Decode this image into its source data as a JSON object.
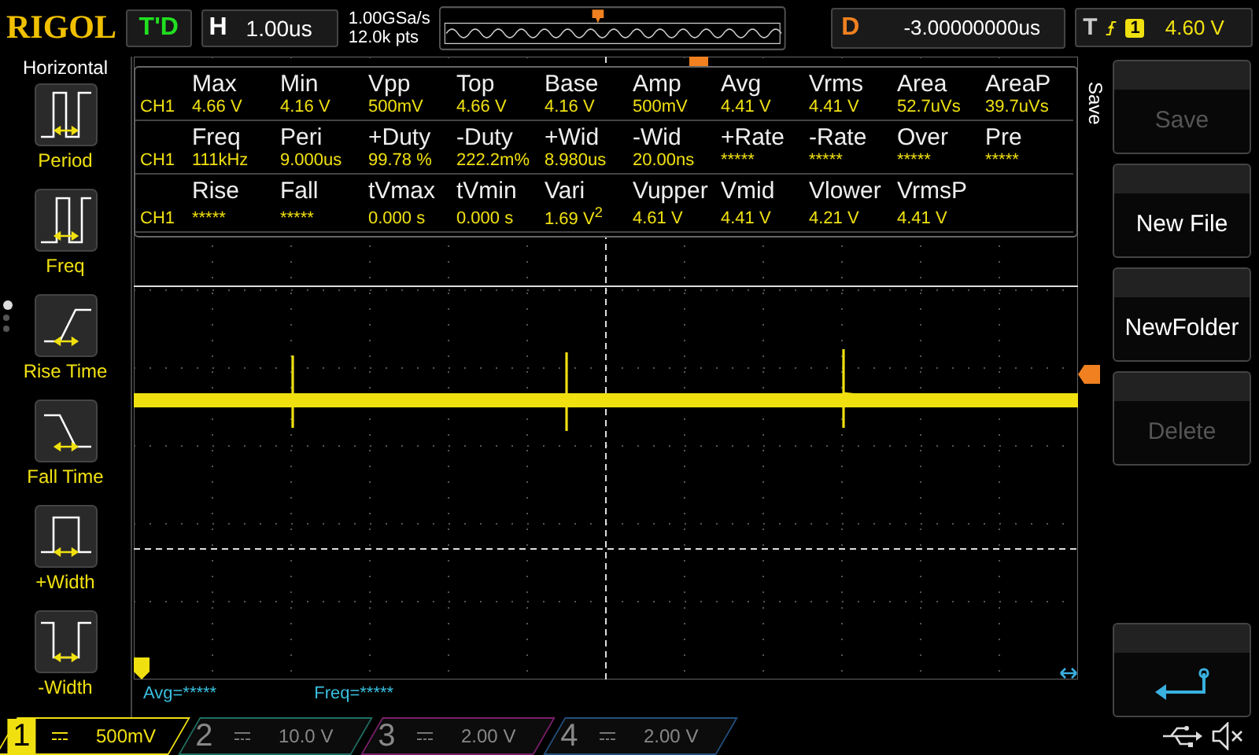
{
  "brand": "RIGOL",
  "run_status": "T'D",
  "timebase": {
    "label": "H",
    "value": "1.00us"
  },
  "sample_rate": "1.00GSa/s",
  "memory_depth": "12.0k pts",
  "delay": {
    "label": "D",
    "value": "-3.00000000us"
  },
  "trigger": {
    "label": "T",
    "source": "1",
    "level": "4.60 V"
  },
  "left_panel": {
    "title": "Horizontal",
    "items": [
      {
        "label": "Period",
        "kind": "period"
      },
      {
        "label": "Freq",
        "kind": "freq"
      },
      {
        "label": "Rise Time",
        "kind": "rise"
      },
      {
        "label": "Fall Time",
        "kind": "fall"
      },
      {
        "label": "+Width",
        "kind": "pwidth"
      },
      {
        "label": "-Width",
        "kind": "nwidth"
      }
    ],
    "pages": [
      {
        "selected": true
      },
      {
        "selected": false
      },
      {
        "selected": false
      }
    ]
  },
  "measurements": [
    {
      "channel": "CH1",
      "names": [
        "Max",
        "Min",
        "Vpp",
        "Top",
        "Base",
        "Amp",
        "Avg",
        "Vrms",
        "Area",
        "AreaP"
      ],
      "values": [
        "4.66 V",
        "4.16 V",
        "500mV",
        "4.66 V",
        "4.16 V",
        "500mV",
        "4.41 V",
        "4.41 V",
        "52.7uVs",
        "39.7uVs"
      ]
    },
    {
      "channel": "CH1",
      "names": [
        "Freq",
        "Peri",
        "+Duty",
        "-Duty",
        "+Wid",
        "-Wid",
        "+Rate",
        "-Rate",
        "Over",
        "Pre"
      ],
      "values": [
        "111kHz",
        "9.000us",
        "99.78 %",
        "222.2m%",
        "8.980us",
        "20.00ns",
        "*****",
        "*****",
        "*****",
        "*****"
      ]
    },
    {
      "channel": "CH1",
      "names": [
        "Rise",
        "Fall",
        "tVmax",
        "tVmin",
        "Vari",
        "Vupper",
        "Vmid",
        "Vlower",
        "VrmsP"
      ],
      "values": [
        "*****",
        "*****",
        "0.000 s",
        "0.000 s",
        {
          "kind": "rich",
          "text": "1.69 V$^{2}$"
        },
        "4.61 V",
        "4.41 V",
        "4.21 V",
        "4.41 V"
      ]
    }
  ],
  "stats": [
    "Avg=*****",
    "Freq=*****"
  ],
  "right_menu": {
    "title": "Save",
    "buttons": [
      {
        "label": "Save",
        "kind": "text",
        "disabled": true
      },
      {
        "label": "New File",
        "kind": "text",
        "disabled": false
      },
      {
        "label": "NewFolder",
        "kind": "text",
        "disabled": false
      },
      {
        "label": "Delete",
        "kind": "text",
        "disabled": true
      },
      {
        "kind": "back"
      }
    ]
  },
  "channels": [
    {
      "number": "1",
      "scale": "500mV",
      "on": true,
      "color": "#f0e010"
    },
    {
      "number": "2",
      "scale": "10.0 V",
      "on": false,
      "color": "#1f6e62"
    },
    {
      "number": "3",
      "scale": "2.00 V",
      "on": false,
      "color": "#7a1f6a"
    },
    {
      "number": "4",
      "scale": "2.00 V",
      "on": false,
      "color": "#234f7e"
    }
  ]
}
